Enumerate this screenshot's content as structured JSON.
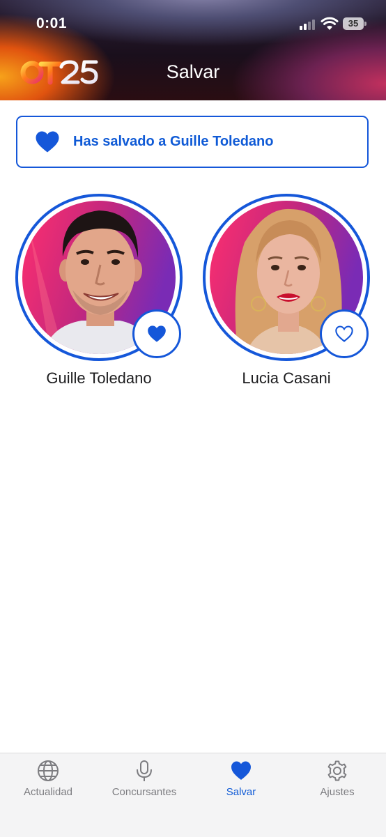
{
  "status_bar": {
    "time": "0:01",
    "battery": "35"
  },
  "header": {
    "logo_text": "OT25",
    "title": "Salvar"
  },
  "banner": {
    "text": "Has salvado a Guille Toledano"
  },
  "contestants": [
    {
      "name": "Guille Toledano",
      "saved": true
    },
    {
      "name": "Lucia Casani",
      "saved": false
    }
  ],
  "tabs": [
    {
      "label": "Actualidad",
      "icon": "globe-icon",
      "active": false
    },
    {
      "label": "Concursantes",
      "icon": "microphone-icon",
      "active": false
    },
    {
      "label": "Salvar",
      "icon": "heart-icon",
      "active": true
    },
    {
      "label": "Ajustes",
      "icon": "gear-icon",
      "active": false
    }
  ],
  "colors": {
    "accent": "#1557d9",
    "tab_inactive": "#7c7c80"
  }
}
